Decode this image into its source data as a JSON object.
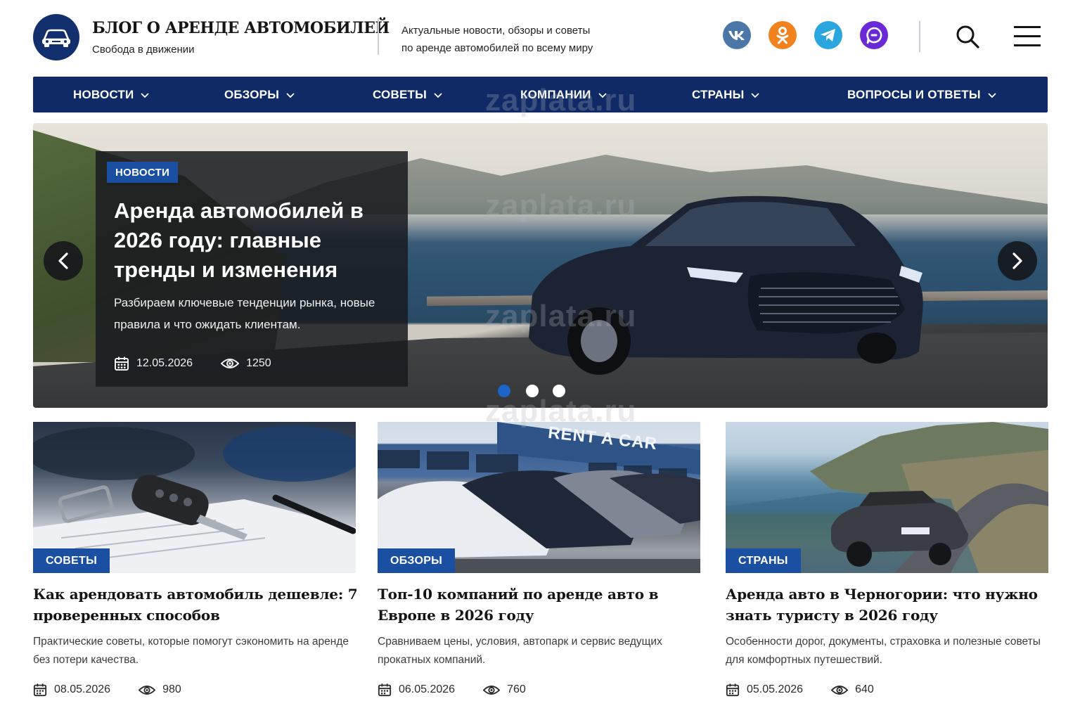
{
  "header": {
    "brand_title": "БЛОГ О АРЕНДЕ АВТОМОБИЛЕЙ",
    "brand_subtitle": "Свобода в движении",
    "tagline_line1": "Актуальные новости, обзоры и советы",
    "tagline_line2": "по аренде автомобилей по всему миру",
    "social": [
      {
        "name": "vk-icon",
        "label": "VK",
        "color": "#4a76a8"
      },
      {
        "name": "odnoklassniki-icon",
        "color": "#f2821e"
      },
      {
        "name": "telegram-icon",
        "color": "#2aa6df"
      },
      {
        "name": "max-messenger-icon",
        "color": "#6b28d6"
      }
    ],
    "icons": [
      "search-icon",
      "menu-icon"
    ]
  },
  "nav": {
    "items": [
      {
        "label": "НОВОСТИ"
      },
      {
        "label": "ОБЗОРЫ"
      },
      {
        "label": "СОВЕТЫ"
      },
      {
        "label": "КОМПАНИИ"
      },
      {
        "label": "СТРАНЫ"
      },
      {
        "label": "ВОПРОСЫ И ОТВЕТЫ"
      }
    ],
    "background": "#0f2a66"
  },
  "hero": {
    "badge": "НОВОСТИ",
    "title": "Аренда автомобилей в 2026 году: главные тренды и изменения",
    "description": "Разбираем ключевые тенденции рынка, новые правила и что ожидать клиентам.",
    "date": "12.05.2026",
    "views": "1250",
    "slides_total": 3,
    "active_slide": 1
  },
  "cards": [
    {
      "badge": "СОВЕТЫ",
      "title": "Как арендовать автомобиль дешевле: 7 проверенных способов",
      "description": "Практические советы, которые помогут сэкономить на аренде без потери качества.",
      "date": "08.05.2026",
      "views": "980"
    },
    {
      "badge": "ОБЗОРЫ",
      "image_sign": "RENT A CAR",
      "title": "Топ-10 компаний по аренде авто в Европе в 2026 году",
      "description": "Сравниваем цены, условия, автопарк и сервис ведущих прокатных компаний.",
      "date": "06.05.2026",
      "views": "760"
    },
    {
      "badge": "СТРАНЫ",
      "title": "Аренда авто в Черногории: что нужно знать туристу в 2026 году",
      "description": "Особенности дорог, документы, страховка и полезные советы для комфортных путешествий.",
      "date": "05.05.2026",
      "views": "640"
    }
  ],
  "watermark": "zaplata.ru",
  "colors": {
    "accent": "#1b4fa1",
    "navy": "#0f2a66",
    "dot_active": "#1d64c8"
  }
}
